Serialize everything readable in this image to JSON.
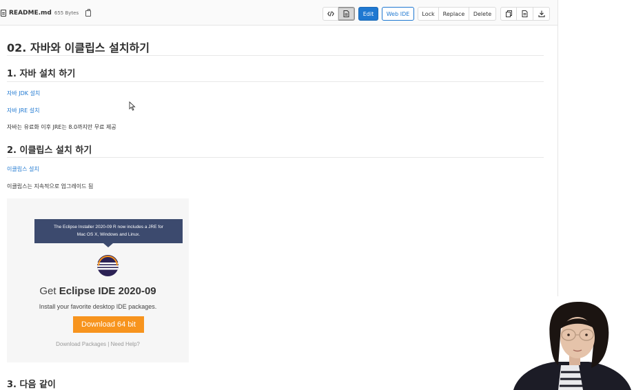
{
  "file": {
    "name": "README.md",
    "size": "655 Bytes"
  },
  "toolbar": {
    "edit": "Edit",
    "web_ide": "Web IDE",
    "lock": "Lock",
    "replace": "Replace",
    "delete": "Delete"
  },
  "doc": {
    "title": "02. 자바와 이클립스 설치하기",
    "section1": {
      "heading": "1. 자바 설치 하기",
      "links": [
        "자바 JDK 설치",
        "자바 JRE 설치"
      ],
      "note": "자바는 유료화 이후 JRE는 8.0까지만 무료 제공"
    },
    "section2": {
      "heading": "2. 이클립스 설치 하기",
      "link": "이클립스 설치",
      "note": "이클립스는 지속적으로 업그레이드 됨"
    },
    "section3_partial": "3. 다음 같이"
  },
  "eclipse": {
    "banner_line1": "The Eclipse Installer 2020-09 R now includes a JRE for",
    "banner_line2": "Mac OS X, Windows and Linux.",
    "get_prefix": "Get",
    "get_product": "Eclipse IDE 2020-09",
    "install_text": "Install your favorite desktop IDE packages.",
    "download_button": "Download 64 bit",
    "download_packages": "Download Packages",
    "separator": "|",
    "need_help": "Need Help?"
  },
  "colors": {
    "link": "#1f78d1",
    "primary": "#1f78d1",
    "banner": "#3c4a6e",
    "download": "#f7941e"
  }
}
